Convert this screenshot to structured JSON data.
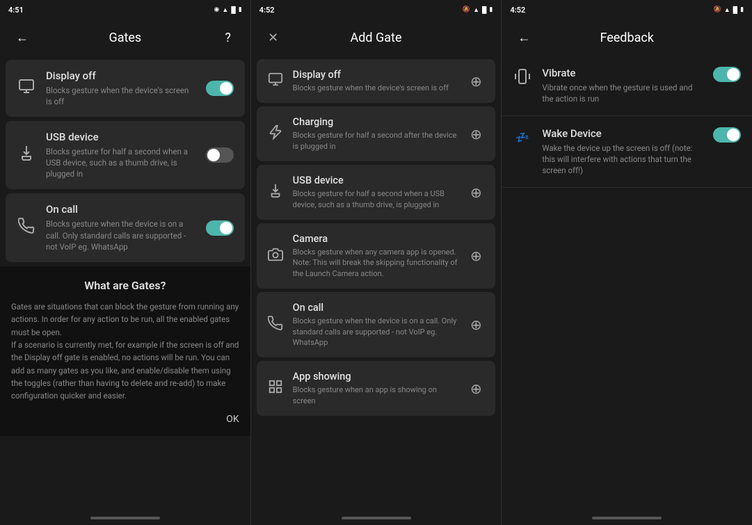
{
  "panels": {
    "left": {
      "status": {
        "time": "4:51"
      },
      "title": "Gates",
      "items": [
        {
          "icon": "🖥",
          "title": "Display off",
          "desc": "Blocks gesture when the device's screen is off",
          "toggle": "on"
        },
        {
          "icon": "🔌",
          "title": "USB device",
          "desc": "Blocks gesture for half a second when a USB device, such as a thumb drive, is plugged in",
          "toggle": "off"
        },
        {
          "icon": "📞",
          "title": "On call",
          "desc": "Blocks gesture when the device is on a call. Only standard calls are supported - not VoIP eg. WhatsApp",
          "toggle": "on"
        }
      ],
      "info": {
        "title": "What are Gates?",
        "text": "Gates are situations that can block the gesture from running any actions. In order for any action to be run, all the enabled gates must be open.\nIf a scenario is currently met, for example if the screen is off and the Display off gate is enabled, no actions will be run. You can add as many gates as you like, and enable/disable them using the toggles (rather than having to delete and re-add) to make configuration quicker and easier.",
        "ok_label": "OK"
      }
    },
    "middle": {
      "status": {
        "time": "4:52"
      },
      "title": "Add Gate",
      "items": [
        {
          "icon": "🖥",
          "title": "Display off",
          "desc": "Blocks gesture when the device's screen is off"
        },
        {
          "icon": "⚡",
          "title": "Charging",
          "desc": "Blocks gesture for half a second after the device is plugged in"
        },
        {
          "icon": "🔌",
          "title": "USB device",
          "desc": "Blocks gesture for half a second when a USB device, such as a thumb drive, is plugged in"
        },
        {
          "icon": "📷",
          "title": "Camera",
          "desc": "Blocks gesture when any camera app is opened. Note: This will break the skipping functionality of the Launch Camera action."
        },
        {
          "icon": "📞",
          "title": "On call",
          "desc": "Blocks gesture when the device is on a call. Only standard calls are supported - not VoIP eg. WhatsApp"
        },
        {
          "icon": "⊞",
          "title": "App showing",
          "desc": "Blocks gesture when an app is showing on screen"
        }
      ]
    },
    "right": {
      "status": {
        "time": "4:52"
      },
      "title": "Feedback",
      "items": [
        {
          "icon": "📳",
          "title": "Vibrate",
          "desc": "Vibrate once when the gesture is used and the action is run",
          "toggle": "on"
        },
        {
          "icon": "💤",
          "title": "Wake Device",
          "desc": "Wake the device up the screen is off (note: this will interfere with actions that turn the screen off!)",
          "toggle": "on"
        }
      ]
    }
  }
}
